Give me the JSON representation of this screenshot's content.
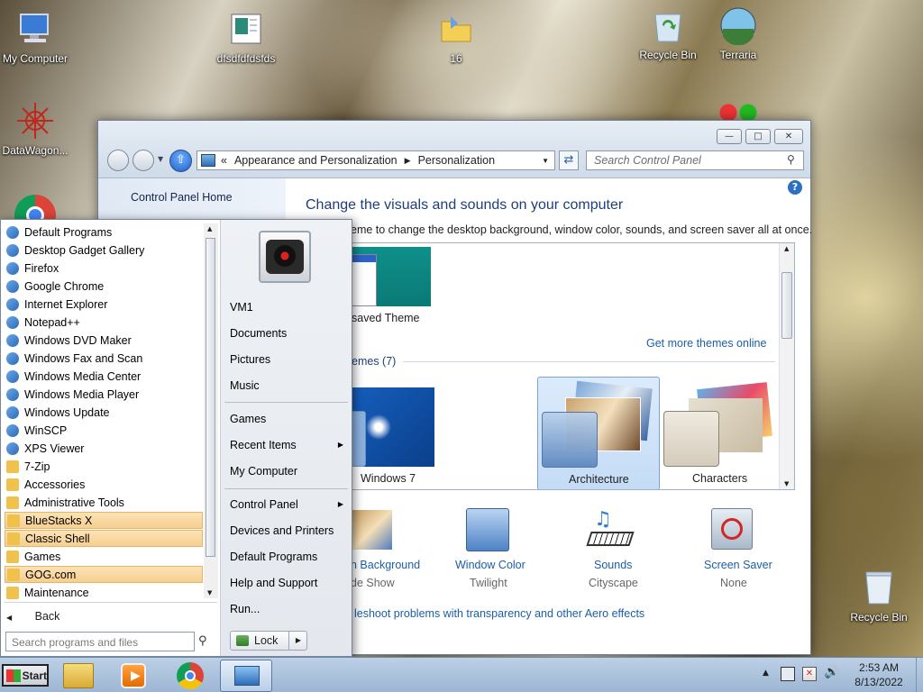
{
  "desktop": {
    "icons": [
      {
        "label": "My Computer",
        "icon": "computer-icon"
      },
      {
        "label": "dfsdfdfdsfds",
        "icon": "document-icon"
      },
      {
        "label": "16",
        "icon": "folder-icon"
      },
      {
        "label": "Recycle Bin",
        "icon": "recycle-bin-full-icon"
      },
      {
        "label": "Terraria",
        "icon": "terraria-icon"
      },
      {
        "label": "DataWagon...",
        "icon": "datawagon-icon"
      },
      {
        "label": "Recycle Bin",
        "icon": "recycle-bin-empty-icon"
      }
    ]
  },
  "window": {
    "address": {
      "root": "Appearance and Personalization",
      "current": "Personalization"
    },
    "search_placeholder": "Search Control Panel",
    "left_pane": {
      "home_link": "Control Panel Home"
    },
    "heading": "Change the visuals and sounds on your computer",
    "subtitle": "eme to change the desktop background, window color, sounds, and screen saver all at once.",
    "saved_theme_label": "saved Theme",
    "get_more_link": "Get more themes online",
    "group_label": "emes (7)",
    "themes": [
      {
        "name": "Windows 7",
        "selected": false
      },
      {
        "name": "Architecture",
        "selected": true
      },
      {
        "name": "Characters",
        "selected": false
      }
    ],
    "settings": [
      {
        "title": "n Background",
        "value": "de Show",
        "icon": "desktop-background-icon"
      },
      {
        "title": "Window Color",
        "value": "Twilight",
        "icon": "window-color-icon"
      },
      {
        "title": "Sounds",
        "value": "Cityscape",
        "icon": "sounds-icon"
      },
      {
        "title": "Screen Saver",
        "value": "None",
        "icon": "screen-saver-icon"
      }
    ],
    "troubleshoot_link": "leshoot problems with transparency and other Aero effects"
  },
  "start_menu": {
    "programs": [
      {
        "label": "Default Programs",
        "icon": "default-programs-icon",
        "highlight": false
      },
      {
        "label": "Desktop Gadget Gallery",
        "icon": "gadget-icon",
        "highlight": false
      },
      {
        "label": "Firefox",
        "icon": "firefox-icon",
        "highlight": false
      },
      {
        "label": "Google Chrome",
        "icon": "chrome-icon",
        "highlight": false
      },
      {
        "label": "Internet Explorer",
        "icon": "ie-icon",
        "highlight": false
      },
      {
        "label": "Notepad++",
        "icon": "notepad-icon",
        "highlight": false
      },
      {
        "label": "Windows DVD Maker",
        "icon": "dvd-icon",
        "highlight": false
      },
      {
        "label": "Windows Fax and Scan",
        "icon": "fax-icon",
        "highlight": false
      },
      {
        "label": "Windows Media Center",
        "icon": "media-center-icon",
        "highlight": false
      },
      {
        "label": "Windows Media Player",
        "icon": "media-player-icon",
        "highlight": false
      },
      {
        "label": "Windows Update",
        "icon": "update-icon",
        "highlight": false
      },
      {
        "label": "WinSCP",
        "icon": "winscp-icon",
        "highlight": false
      },
      {
        "label": "XPS Viewer",
        "icon": "xps-icon",
        "highlight": false
      },
      {
        "label": "7-Zip",
        "icon": "folder-icon",
        "highlight": false
      },
      {
        "label": "Accessories",
        "icon": "folder-icon",
        "highlight": false
      },
      {
        "label": "Administrative Tools",
        "icon": "folder-icon",
        "highlight": false
      },
      {
        "label": "BlueStacks X",
        "icon": "folder-icon",
        "highlight": true
      },
      {
        "label": "Classic Shell",
        "icon": "folder-icon",
        "highlight": true
      },
      {
        "label": "Games",
        "icon": "folder-icon",
        "highlight": false
      },
      {
        "label": "GOG.com",
        "icon": "folder-icon",
        "highlight": true
      },
      {
        "label": "Maintenance",
        "icon": "folder-icon",
        "highlight": false
      }
    ],
    "back_label": "Back",
    "search_placeholder": "Search programs and files",
    "right_items_a": [
      "VM1",
      "Documents",
      "Pictures",
      "Music"
    ],
    "right_items_b": [
      {
        "label": "Games",
        "arrow": false
      },
      {
        "label": "Recent Items",
        "arrow": true
      },
      {
        "label": "My Computer",
        "arrow": false
      }
    ],
    "right_items_c": [
      {
        "label": "Control Panel",
        "arrow": true
      },
      {
        "label": "Devices and Printers",
        "arrow": false
      },
      {
        "label": "Default Programs",
        "arrow": false
      },
      {
        "label": "Help and Support",
        "arrow": false
      },
      {
        "label": "Run...",
        "arrow": false
      }
    ],
    "lock_label": "Lock"
  },
  "taskbar": {
    "start_label": "Start",
    "clock_time": "2:53 AM",
    "clock_date": "8/13/2022"
  }
}
